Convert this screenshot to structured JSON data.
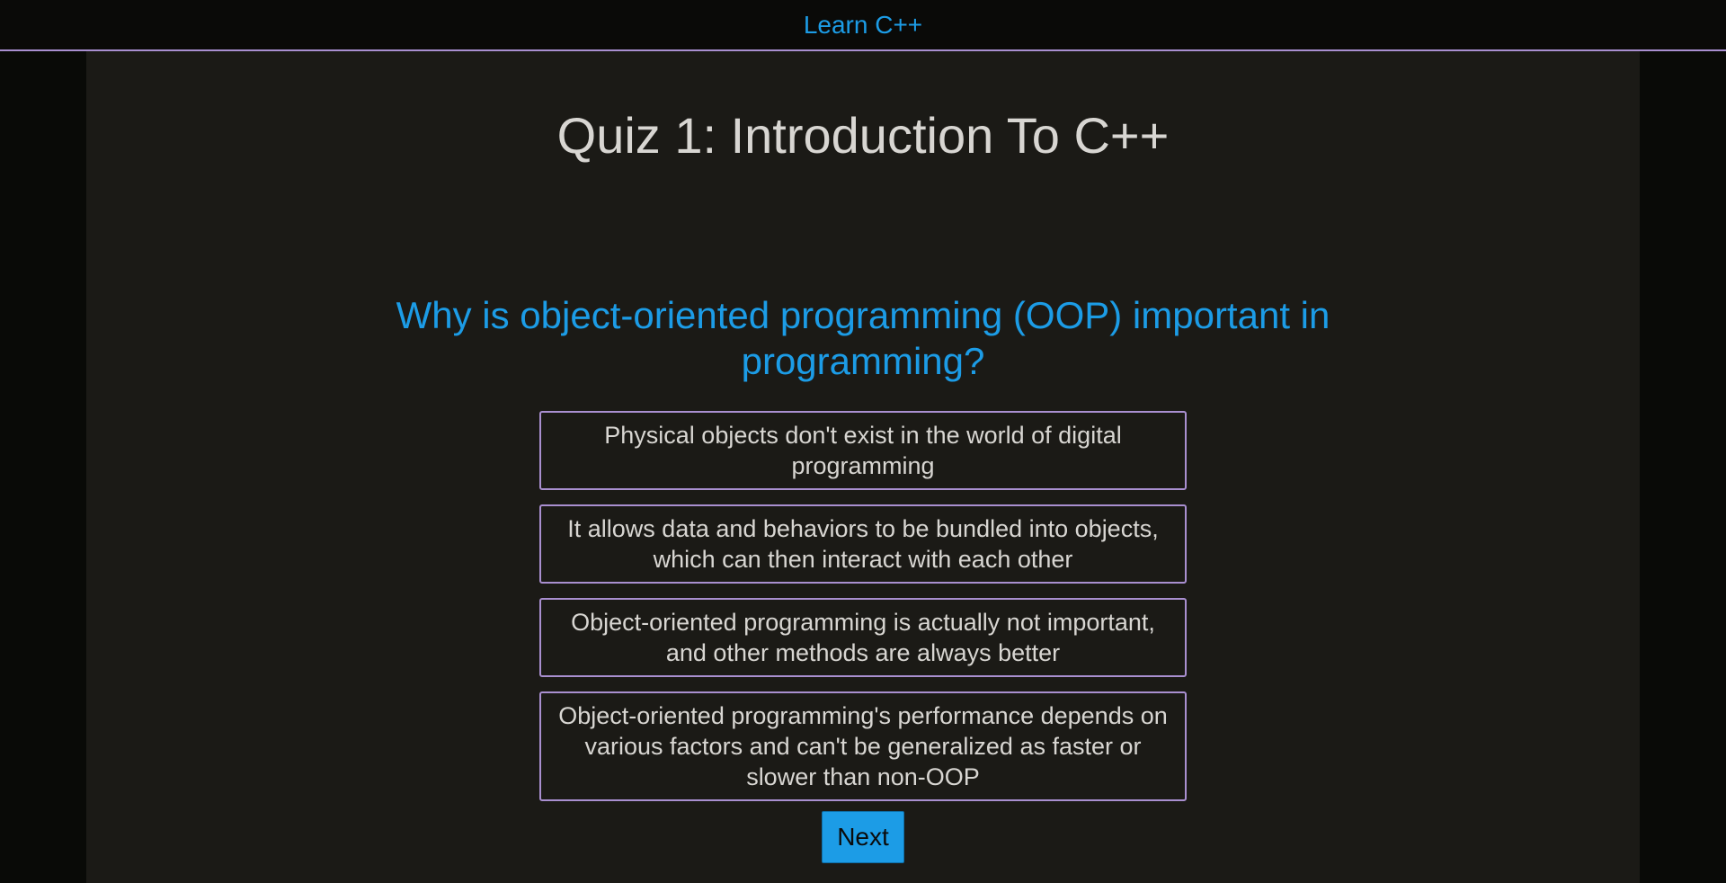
{
  "header": {
    "brand": "Learn C++"
  },
  "quiz": {
    "title": "Quiz 1: Introduction To C++",
    "question": "Why is object-oriented programming (OOP) important in programming?",
    "answers": [
      "Physical objects don't exist in the world of digital programming",
      "It allows data and behaviors to be bundled into objects, which can then interact with each other",
      "Object-oriented programming is actually not important, and other methods are always better",
      "Object-oriented programming's performance depends on various factors and can't be generalized as faster or slower than non-OOP"
    ],
    "next_label": "Next"
  },
  "colors": {
    "accent": "#1c9ce6",
    "border": "#a98fd0",
    "panel": "#1b1a16",
    "background": "#090a07",
    "text": "#d8d6d2"
  }
}
